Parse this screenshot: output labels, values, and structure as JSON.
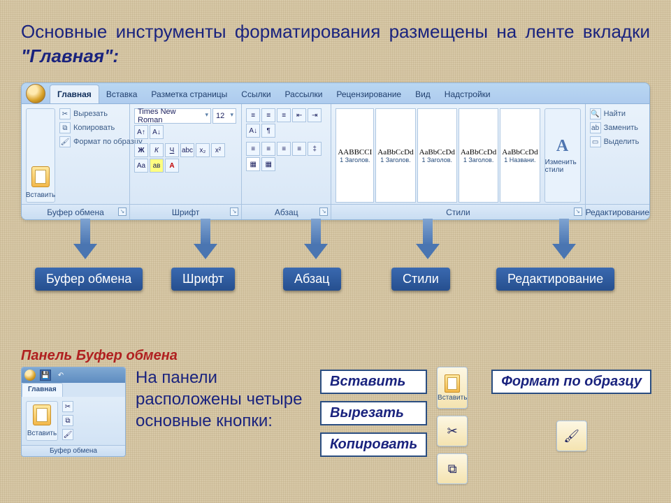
{
  "heading": {
    "line1": "Основные инструменты форматирования размещены на ленте вкладки ",
    "em": "\"Главная\":"
  },
  "ribbon": {
    "tabs": [
      "Главная",
      "Вставка",
      "Разметка страницы",
      "Ссылки",
      "Рассылки",
      "Рецензирование",
      "Вид",
      "Надстройки"
    ],
    "active_tab": "Главная",
    "groups": {
      "clipboard": {
        "label": "Буфер обмена",
        "paste": "Вставить",
        "cut": "Вырезать",
        "copy": "Копировать",
        "format_painter": "Формат по образцу"
      },
      "font": {
        "label": "Шрифт",
        "font_name": "Times New Roman",
        "font_size": "12",
        "buttons": [
          "Ж",
          "К",
          "Ч",
          "abc",
          "x₂",
          "x²",
          "Aa",
          "aʙ",
          "A"
        ]
      },
      "paragraph": {
        "label": "Абзац"
      },
      "styles": {
        "label": "Стили",
        "items": [
          {
            "sample": "AABBCCI",
            "name": "1 Заголов."
          },
          {
            "sample": "AaBbCcDd",
            "name": "1 Заголов."
          },
          {
            "sample": "AaBbCcDd",
            "name": "1 Заголов."
          },
          {
            "sample": "AaBbCcDd",
            "name": "1 Заголов."
          },
          {
            "sample": "AaBbCcDd",
            "name": "1 Названи."
          }
        ],
        "change": "Изменить стили"
      },
      "editing": {
        "label": "Редактирование",
        "find": "Найти",
        "replace": "Заменить",
        "select": "Выделить"
      }
    }
  },
  "tags": {
    "clipboard": "Буфер обмена",
    "font": "Шрифт",
    "paragraph": "Абзац",
    "styles": "Стили",
    "editing": "Редактирование"
  },
  "lower": {
    "panel_title": "Панель Буфер обмена",
    "desc": "На панели расположены четыре основные кнопки:",
    "labels": {
      "paste": "Вставить",
      "cut": "Вырезать",
      "copy": "Копировать",
      "format_painter": "Формат по образцу"
    },
    "mini": {
      "tab": "Главная",
      "paste": "Вставить",
      "group": "Буфер обмена"
    }
  }
}
